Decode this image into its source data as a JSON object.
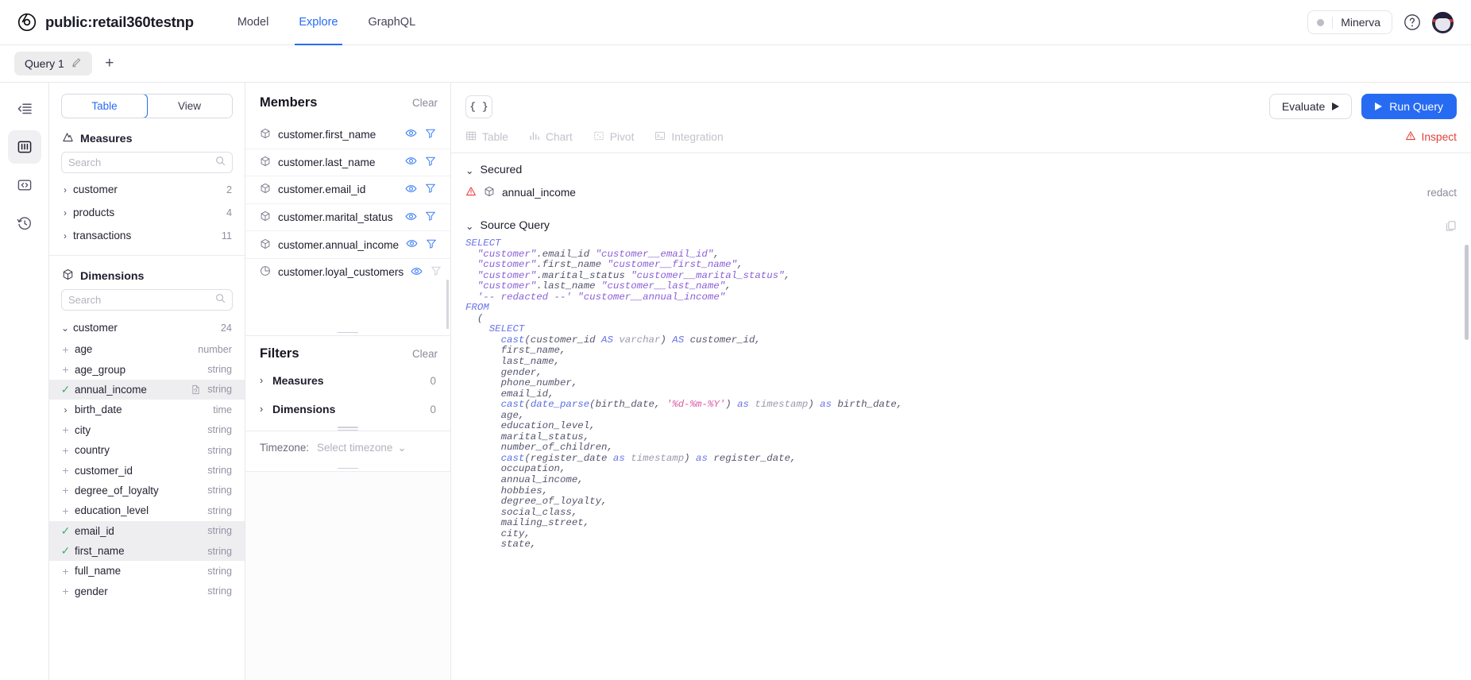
{
  "topbar": {
    "brand_title": "public:retail360testnp",
    "nav": [
      {
        "label": "Model",
        "active": false
      },
      {
        "label": "Explore",
        "active": true
      },
      {
        "label": "GraphQL",
        "active": false
      }
    ],
    "env_label": "Minerva",
    "help_icon": "help-circle-icon",
    "avatar_icon": "user-avatar"
  },
  "query_tabs": {
    "tab_label": "Query 1",
    "add_label": "+"
  },
  "rail": {
    "items": [
      {
        "icon": "collapse-sidebar-icon",
        "active": false
      },
      {
        "icon": "columns-panel-icon",
        "active": true
      },
      {
        "icon": "code-brackets-icon",
        "active": false
      },
      {
        "icon": "history-clock-icon",
        "active": false
      }
    ]
  },
  "left_panel": {
    "segmented": [
      {
        "label": "Table",
        "active": true
      },
      {
        "label": "View",
        "active": false
      }
    ],
    "measures": {
      "title": "Measures",
      "icon": "measures-icon",
      "search_placeholder": "Search",
      "cubes": [
        {
          "name": "customer",
          "count": "2",
          "expanded": false
        },
        {
          "name": "products",
          "count": "4",
          "expanded": false
        },
        {
          "name": "transactions",
          "count": "11",
          "expanded": false
        }
      ]
    },
    "dimensions": {
      "title": "Dimensions",
      "icon": "cube-icon",
      "search_placeholder": "Search",
      "cube_name": "customer",
      "cube_count": "24",
      "cube_expanded": true,
      "items": [
        {
          "name": "age",
          "type": "number",
          "state": "add"
        },
        {
          "name": "age_group",
          "type": "string",
          "state": "add"
        },
        {
          "name": "annual_income",
          "type": "string",
          "state": "selected",
          "secured": true
        },
        {
          "name": "birth_date",
          "type": "time",
          "state": "expandable"
        },
        {
          "name": "city",
          "type": "string",
          "state": "add"
        },
        {
          "name": "country",
          "type": "string",
          "state": "add"
        },
        {
          "name": "customer_id",
          "type": "string",
          "state": "add"
        },
        {
          "name": "degree_of_loyalty",
          "type": "string",
          "state": "add"
        },
        {
          "name": "education_level",
          "type": "string",
          "state": "add"
        },
        {
          "name": "email_id",
          "type": "string",
          "state": "selected"
        },
        {
          "name": "first_name",
          "type": "string",
          "state": "selected"
        },
        {
          "name": "full_name",
          "type": "string",
          "state": "add"
        },
        {
          "name": "gender",
          "type": "string",
          "state": "add"
        }
      ]
    }
  },
  "members_panel": {
    "title": "Members",
    "clear_label": "Clear",
    "items": [
      {
        "name": "customer.first_name",
        "kind": "dimension",
        "filter_enabled": true
      },
      {
        "name": "customer.last_name",
        "kind": "dimension",
        "filter_enabled": true
      },
      {
        "name": "customer.email_id",
        "kind": "dimension",
        "filter_enabled": true
      },
      {
        "name": "customer.marital_status",
        "kind": "dimension",
        "filter_enabled": true
      },
      {
        "name": "customer.annual_income",
        "kind": "dimension",
        "filter_enabled": true
      },
      {
        "name": "customer.loyal_customers",
        "kind": "measure",
        "filter_enabled": false
      }
    ],
    "filters": {
      "title": "Filters",
      "clear_label": "Clear",
      "groups": [
        {
          "label": "Measures",
          "count": "0"
        },
        {
          "label": "Dimensions",
          "count": "0"
        }
      ]
    },
    "timezone": {
      "label": "Timezone:",
      "value": "Select timezone"
    }
  },
  "main": {
    "json_btn_label": "{ }",
    "evaluate_label": "Evaluate",
    "run_query_label": "Run Query",
    "view_tabs": [
      {
        "label": "Table",
        "icon": "table-icon"
      },
      {
        "label": "Chart",
        "icon": "bar-chart-icon"
      },
      {
        "label": "Pivot",
        "icon": "pivot-icon"
      },
      {
        "label": "Integration",
        "icon": "terminal-icon"
      }
    ],
    "inspect_label": "Inspect",
    "inspect_icon": "warning-triangle-icon",
    "secured": {
      "title": "Secured",
      "member": "annual_income",
      "action_label": "redact",
      "warning_icon": "warning-triangle-icon"
    },
    "source_query": {
      "title": "Source Query",
      "copy_icon": "copy-icon",
      "lines": [
        [
          {
            "t": "SELECT",
            "c": "kw"
          }
        ],
        [
          {
            "t": "  ",
            "c": "pl"
          },
          {
            "t": "\"customer\"",
            "c": "str"
          },
          {
            "t": ".email_id ",
            "c": "pl"
          },
          {
            "t": "\"customer__email_id\"",
            "c": "str"
          },
          {
            "t": ",",
            "c": "pl"
          }
        ],
        [
          {
            "t": "  ",
            "c": "pl"
          },
          {
            "t": "\"customer\"",
            "c": "str"
          },
          {
            "t": ".first_name ",
            "c": "pl"
          },
          {
            "t": "\"customer__first_name\"",
            "c": "str"
          },
          {
            "t": ",",
            "c": "pl"
          }
        ],
        [
          {
            "t": "  ",
            "c": "pl"
          },
          {
            "t": "\"customer\"",
            "c": "str"
          },
          {
            "t": ".marital_status ",
            "c": "pl"
          },
          {
            "t": "\"customer__marital_status\"",
            "c": "str"
          },
          {
            "t": ",",
            "c": "pl"
          }
        ],
        [
          {
            "t": "  ",
            "c": "pl"
          },
          {
            "t": "\"customer\"",
            "c": "str"
          },
          {
            "t": ".last_name ",
            "c": "pl"
          },
          {
            "t": "\"customer__last_name\"",
            "c": "str"
          },
          {
            "t": ",",
            "c": "pl"
          }
        ],
        [
          {
            "t": "  ",
            "c": "pl"
          },
          {
            "t": "'-- redacted --'",
            "c": "str"
          },
          {
            "t": " ",
            "c": "pl"
          },
          {
            "t": "\"customer__annual_income\"",
            "c": "str"
          }
        ],
        [
          {
            "t": "FROM",
            "c": "kw"
          }
        ],
        [
          {
            "t": "  (",
            "c": "pl"
          }
        ],
        [
          {
            "t": "    ",
            "c": "pl"
          },
          {
            "t": "SELECT",
            "c": "kw"
          }
        ],
        [
          {
            "t": "      ",
            "c": "pl"
          },
          {
            "t": "cast",
            "c": "fn"
          },
          {
            "t": "(customer_id ",
            "c": "pl"
          },
          {
            "t": "AS",
            "c": "kw"
          },
          {
            "t": " ",
            "c": "pl"
          },
          {
            "t": "varchar",
            "c": "typ"
          },
          {
            "t": ") ",
            "c": "pl"
          },
          {
            "t": "AS",
            "c": "kw"
          },
          {
            "t": " customer_id,",
            "c": "pl"
          }
        ],
        [
          {
            "t": "      first_name,",
            "c": "pl"
          }
        ],
        [
          {
            "t": "      last_name,",
            "c": "pl"
          }
        ],
        [
          {
            "t": "      gender,",
            "c": "pl"
          }
        ],
        [
          {
            "t": "      phone_number,",
            "c": "pl"
          }
        ],
        [
          {
            "t": "      email_id,",
            "c": "pl"
          }
        ],
        [
          {
            "t": "      ",
            "c": "pl"
          },
          {
            "t": "cast",
            "c": "fn"
          },
          {
            "t": "(",
            "c": "pl"
          },
          {
            "t": "date_parse",
            "c": "fn"
          },
          {
            "t": "(birth_date, ",
            "c": "pl"
          },
          {
            "t": "'%d-%m-%Y'",
            "c": "lit"
          },
          {
            "t": ") ",
            "c": "pl"
          },
          {
            "t": "as",
            "c": "kw"
          },
          {
            "t": " ",
            "c": "pl"
          },
          {
            "t": "timestamp",
            "c": "typ"
          },
          {
            "t": ") ",
            "c": "pl"
          },
          {
            "t": "as",
            "c": "kw"
          },
          {
            "t": " birth_date,",
            "c": "pl"
          }
        ],
        [
          {
            "t": "      age,",
            "c": "pl"
          }
        ],
        [
          {
            "t": "      education_level,",
            "c": "pl"
          }
        ],
        [
          {
            "t": "      marital_status,",
            "c": "pl"
          }
        ],
        [
          {
            "t": "      number_of_children,",
            "c": "pl"
          }
        ],
        [
          {
            "t": "      ",
            "c": "pl"
          },
          {
            "t": "cast",
            "c": "fn"
          },
          {
            "t": "(register_date ",
            "c": "pl"
          },
          {
            "t": "as",
            "c": "kw"
          },
          {
            "t": " ",
            "c": "pl"
          },
          {
            "t": "timestamp",
            "c": "typ"
          },
          {
            "t": ") ",
            "c": "pl"
          },
          {
            "t": "as",
            "c": "kw"
          },
          {
            "t": " register_date,",
            "c": "pl"
          }
        ],
        [
          {
            "t": "      occupation,",
            "c": "pl"
          }
        ],
        [
          {
            "t": "      annual_income,",
            "c": "pl"
          }
        ],
        [
          {
            "t": "      hobbies,",
            "c": "pl"
          }
        ],
        [
          {
            "t": "      degree_of_loyalty,",
            "c": "pl"
          }
        ],
        [
          {
            "t": "      social_class,",
            "c": "pl"
          }
        ],
        [
          {
            "t": "      mailing_street,",
            "c": "pl"
          }
        ],
        [
          {
            "t": "      city,",
            "c": "pl"
          }
        ],
        [
          {
            "t": "      state,",
            "c": "pl"
          }
        ]
      ]
    }
  }
}
